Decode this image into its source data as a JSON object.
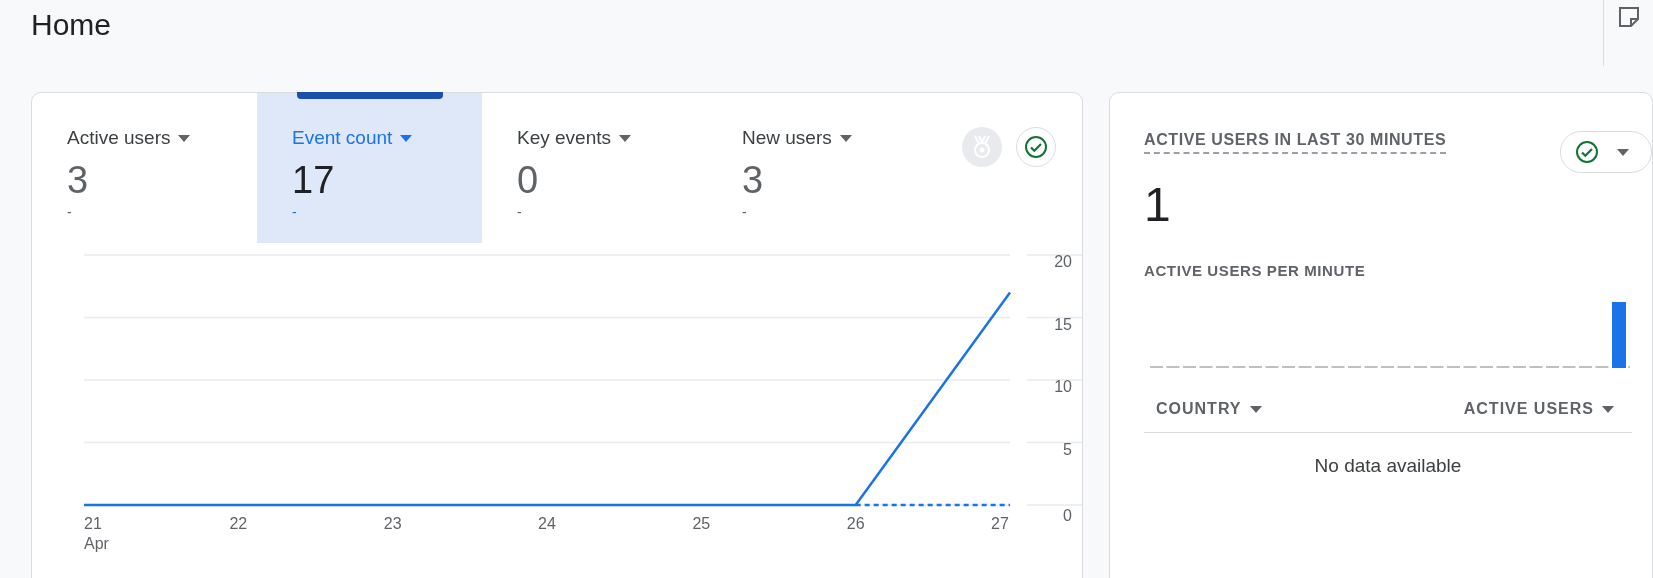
{
  "page": {
    "title": "Home"
  },
  "overview_card": {
    "metrics": [
      {
        "label": "Active users",
        "value": "3",
        "change": "-",
        "selected": false
      },
      {
        "label": "Event count",
        "value": "17",
        "change": "-",
        "selected": true
      },
      {
        "label": "Key events",
        "value": "0",
        "change": "-",
        "selected": false
      },
      {
        "label": "New users",
        "value": "3",
        "change": "-",
        "selected": false
      }
    ],
    "chart_data": {
      "type": "line",
      "categories": [
        {
          "day": "21",
          "month": "Apr"
        },
        {
          "day": "22"
        },
        {
          "day": "23"
        },
        {
          "day": "24"
        },
        {
          "day": "25"
        },
        {
          "day": "26"
        },
        {
          "day": "27"
        }
      ],
      "series": [
        {
          "color": "#1a73e8",
          "line_style": "solid",
          "values": [
            0,
            0,
            0,
            0,
            0,
            0,
            17
          ]
        },
        {
          "color": "#1a73e8",
          "line_style": "dashed",
          "values": [
            null,
            null,
            null,
            null,
            null,
            0,
            0
          ]
        }
      ],
      "ylim": [
        0,
        20
      ],
      "yticks": [
        0,
        5,
        10,
        15,
        20
      ],
      "grid": true
    }
  },
  "realtime_card": {
    "title": "ACTIVE USERS IN LAST 30 MINUTES",
    "value": "1",
    "subtitle": "ACTIVE USERS PER MINUTE",
    "table": {
      "columns": [
        "COUNTRY",
        "ACTIVE USERS"
      ],
      "empty_message": "No data available"
    }
  }
}
